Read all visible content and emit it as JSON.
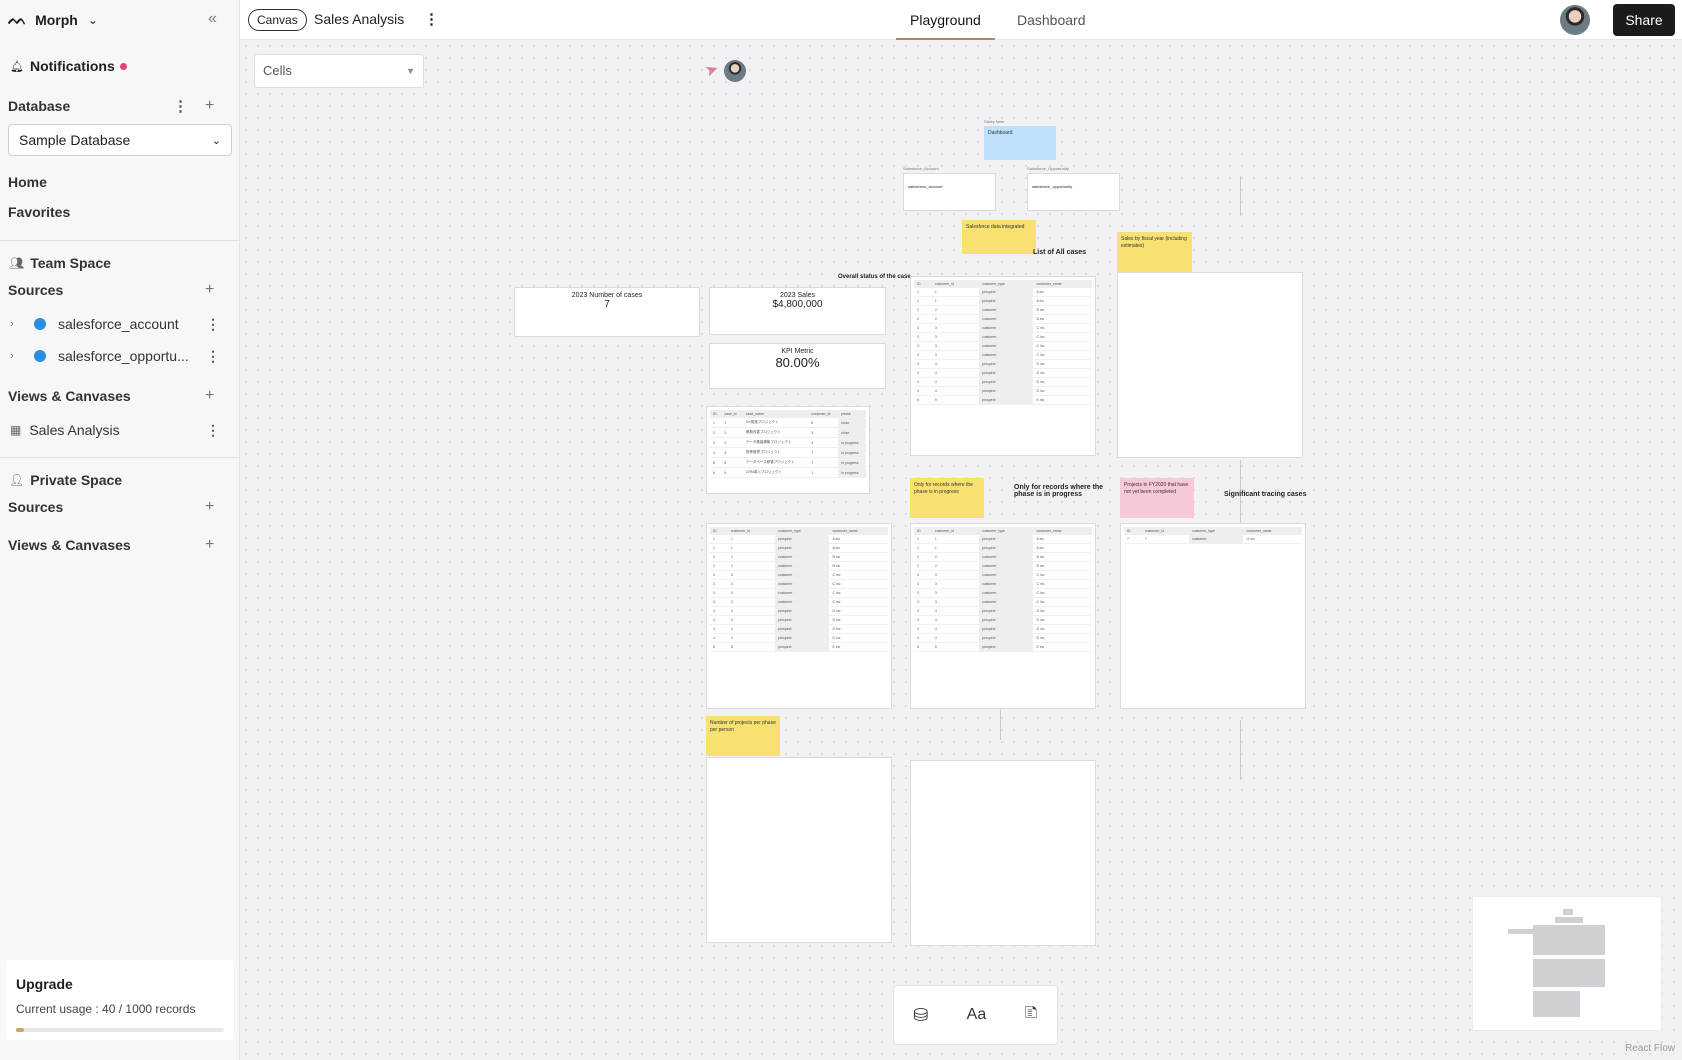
{
  "sidebar": {
    "workspace": "Morph",
    "notifications": "Notifications",
    "database_title": "Database",
    "database_select": "Sample Database",
    "home": "Home",
    "favorites": "Favorites",
    "team_space": "Team Space",
    "sources_title": "Sources",
    "sources": [
      {
        "label": "salesforce_account"
      },
      {
        "label": "salesforce_opportu..."
      }
    ],
    "views_title": "Views & Canvases",
    "views": [
      {
        "label": "Sales Analysis"
      }
    ],
    "private_space": "Private Space",
    "private_sources": "Sources",
    "private_views": "Views & Canvases",
    "upgrade": {
      "title": "Upgrade",
      "usage": "Current usage : 40 / 1000 records",
      "fraction": 0.04
    }
  },
  "topbar": {
    "badge": "Canvas",
    "title": "Sales Analysis",
    "tabs": [
      "Playground",
      "Dashboard"
    ],
    "active_tab": "Playground",
    "share": "Share"
  },
  "canvas": {
    "cells_select": "Cells",
    "nodes": {
      "sticky_dashboard": "Dashboard",
      "src1_label": "Salesforce_Account",
      "src1_name": "salesforce_account",
      "src2_label": "Salesforce_Opportunity",
      "src2_name": "salesforce_opportunity",
      "sticky_integrated": "Salesforce data integrated",
      "txt_all_cases": "List of All cases",
      "sticky_fiscal": "Sales by fiscal year (including estimates)",
      "txt_overall": "Overall status of the case",
      "kpi1_title": "2023 Number of cases",
      "kpi1_value": "7",
      "kpi2_title": "2023 Sales",
      "kpi2_value": "$4,800,000",
      "kpi3_title": "KPI Metric",
      "kpi3_value": "80.00%",
      "sticky_progress": "Only for records where the phase is in progress",
      "txt_progress": "Only for records where the phase is in progress",
      "sticky_fy": "Projects in FY2020 that have not yet been completed",
      "txt_significant": "Significant tracing cases",
      "sticky_projects": "Number of projects per phase per person"
    },
    "table_headers": [
      "ID",
      "customer_id",
      "customer_type",
      "customer_name"
    ],
    "case_headers": [
      "ID",
      "case_id",
      "case_name",
      "customer_id",
      "phase"
    ],
    "cases": [
      [
        "1",
        "1",
        "DX推進プロジェクト",
        "6",
        "close"
      ],
      [
        "2",
        "2",
        "業務改善プロジェクト",
        "3",
        "close"
      ],
      [
        "3",
        "3",
        "データ基盤構築プロジェクト",
        "3",
        "in progress"
      ],
      [
        "4",
        "4",
        "営業管理プロジェクト",
        "7",
        "in progress"
      ],
      [
        "5",
        "5",
        "データベース移管プロジェクト",
        "7",
        "in progress"
      ],
      [
        "6",
        "6",
        "CRM導入プロジェクト",
        "1",
        "in progress"
      ]
    ],
    "customers": [
      [
        "1",
        "1",
        "prospect",
        "A inc"
      ],
      [
        "1",
        "1",
        "prospect",
        "A inc"
      ],
      [
        "2",
        "2",
        "customer",
        "B inc"
      ],
      [
        "2",
        "2",
        "customer",
        "B inc"
      ],
      [
        "3",
        "3",
        "customer",
        "C inc"
      ],
      [
        "3",
        "3",
        "customer",
        "C inc"
      ],
      [
        "3",
        "3",
        "customer",
        "C inc"
      ],
      [
        "3",
        "3",
        "customer",
        "C inc"
      ],
      [
        "4",
        "4",
        "prospect",
        "D inc"
      ],
      [
        "4",
        "4",
        "prospect",
        "D inc"
      ],
      [
        "4",
        "4",
        "prospect",
        "D inc"
      ],
      [
        "4",
        "4",
        "prospect",
        "D inc"
      ],
      [
        "5",
        "5",
        "prospect",
        "E inc"
      ]
    ],
    "single_row": [
      "7",
      "7",
      "customer",
      "G inc"
    ]
  },
  "footer": {
    "react_flow": "React Flow"
  },
  "colors": {
    "accent": "#b58370",
    "sticky_yellow": "#f8e071",
    "sticky_blue": "#bfe0fb",
    "sticky_pink": "#f7c8d7",
    "source_dot": "#2b8ee0"
  }
}
